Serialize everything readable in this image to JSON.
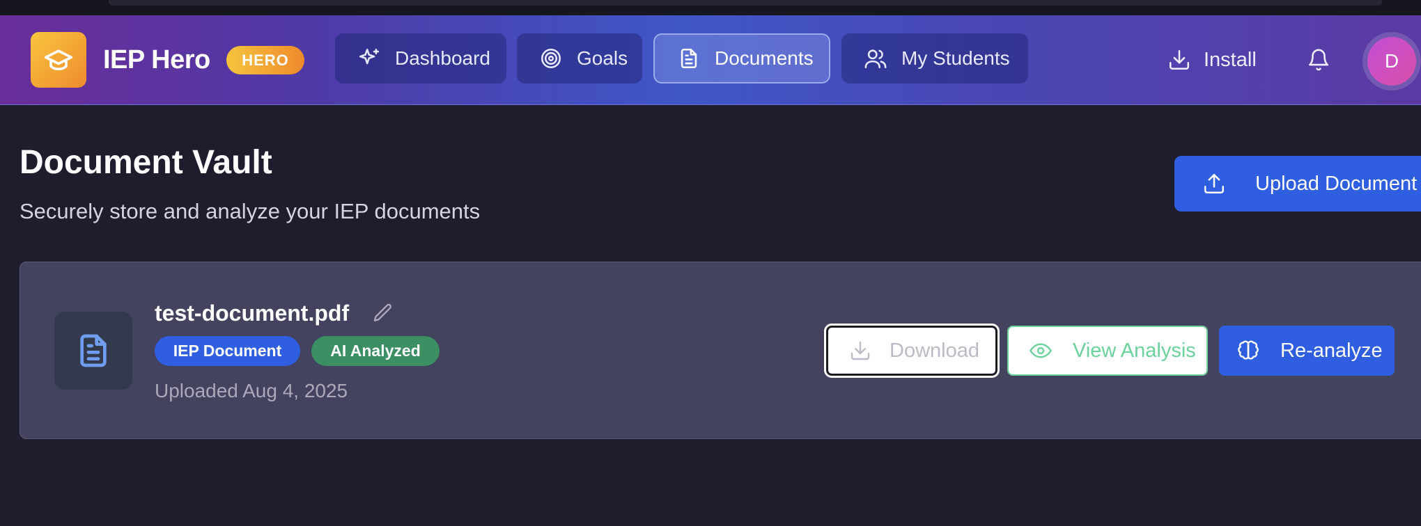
{
  "app": {
    "name": "IEP Hero",
    "badge": "HERO"
  },
  "nav": {
    "items": [
      {
        "label": "Dashboard",
        "icon": "sparkles-icon"
      },
      {
        "label": "Goals",
        "icon": "target-icon"
      },
      {
        "label": "Documents",
        "icon": "document-icon",
        "active": true
      },
      {
        "label": "My Students",
        "icon": "users-icon"
      }
    ],
    "install_label": "Install",
    "avatar_initial": "D"
  },
  "page": {
    "title": "Document Vault",
    "subtitle": "Securely store and analyze your IEP documents",
    "upload_label": "Upload Document"
  },
  "document": {
    "filename": "test-document.pdf",
    "tags": [
      "IEP Document",
      "AI Analyzed"
    ],
    "uploaded": "Uploaded Aug 4, 2025",
    "actions": {
      "download": "Download",
      "view_analysis": "View Analysis",
      "reanalyze": "Re-analyze"
    }
  },
  "colors": {
    "background": "#1d1d2e",
    "primary": "#2f5fe0",
    "success": "#3b8f62",
    "accent_gradient": [
      "#f9c53f",
      "#ee8b2c"
    ],
    "analysis_green": "#6ad29a"
  }
}
